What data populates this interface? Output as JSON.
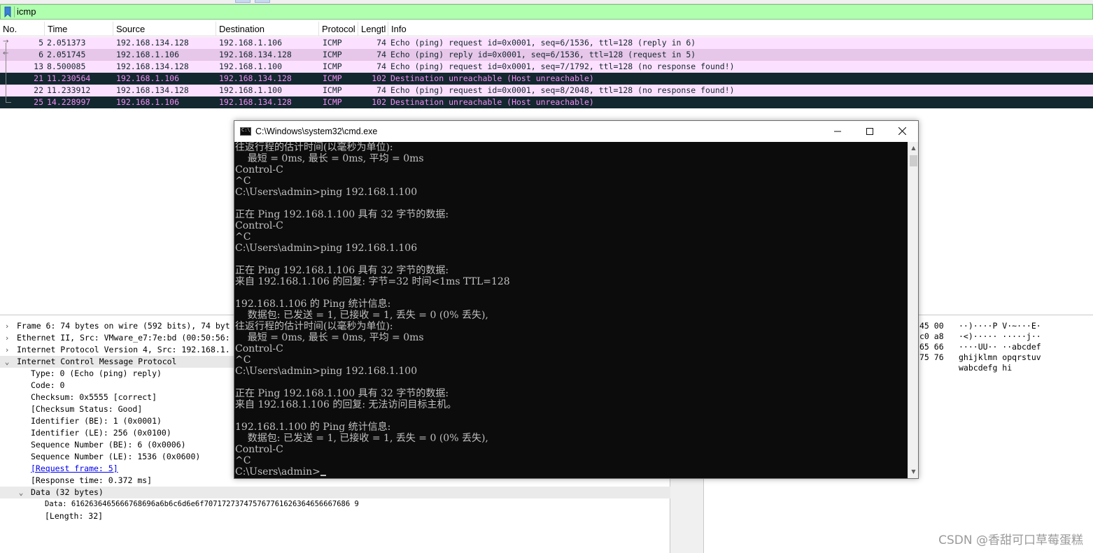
{
  "filter": {
    "value": "icmp"
  },
  "packet_list": {
    "columns": [
      "No.",
      "Time",
      "Source",
      "Destination",
      "Protocol",
      "Lengtl",
      "Info"
    ],
    "rows": [
      {
        "no": "5",
        "time": "2.051373",
        "src": "192.168.134.128",
        "dst": "192.168.1.106",
        "proto": "ICMP",
        "len": "74",
        "info": "Echo (ping) request  id=0x0001, seq=6/1536, ttl=128 (reply in 6)",
        "style": "echo"
      },
      {
        "no": "6",
        "time": "2.051745",
        "src": "192.168.1.106",
        "dst": "192.168.134.128",
        "proto": "ICMP",
        "len": "74",
        "info": "Echo (ping) reply    id=0x0001, seq=6/1536, ttl=128 (request in 5)",
        "style": "echo-sel"
      },
      {
        "no": "13",
        "time": "8.500085",
        "src": "192.168.134.128",
        "dst": "192.168.1.100",
        "proto": "ICMP",
        "len": "74",
        "info": "Echo (ping) request  id=0x0001, seq=7/1792, ttl=128 (no response found!)",
        "style": "echo"
      },
      {
        "no": "21",
        "time": "11.230564",
        "src": "192.168.1.106",
        "dst": "192.168.134.128",
        "proto": "ICMP",
        "len": "102",
        "info": "Destination unreachable (Host unreachable)",
        "style": "unreach"
      },
      {
        "no": "22",
        "time": "11.233912",
        "src": "192.168.134.128",
        "dst": "192.168.1.100",
        "proto": "ICMP",
        "len": "74",
        "info": "Echo (ping) request  id=0x0001, seq=8/2048, ttl=128 (no response found!)",
        "style": "echo"
      },
      {
        "no": "25",
        "time": "14.228997",
        "src": "192.168.1.106",
        "dst": "192.168.134.128",
        "proto": "ICMP",
        "len": "102",
        "info": "Destination unreachable (Host unreachable)",
        "style": "unreach"
      }
    ]
  },
  "details": {
    "frame": "Frame 6: 74 bytes on wire (592 bits), 74 byt",
    "ethernet": "Ethernet II, Src: VMware_e7:7e:bd (00:50:56:",
    "ip": "Internet Protocol Version 4, Src: 192.168.1.",
    "icmp": "Internet Control Message Protocol",
    "icmp_fields": [
      "Type: 0 (Echo (ping) reply)",
      "Code: 0",
      "Checksum: 0x5555 [correct]",
      "[Checksum Status: Good]",
      "Identifier (BE): 1 (0x0001)",
      "Identifier (LE): 256 (0x0100)",
      "Sequence Number (BE): 6 (0x0006)",
      "Sequence Number (LE): 1536 (0x0600)"
    ],
    "request_frame": "[Request frame: 5]",
    "response_time": "[Response time: 0.372 ms]",
    "data_header": "Data (32 bytes)",
    "data_value": "Data: 6162636465666768696a6b6c6d6e6f707172737475767761626364656667686 9",
    "data_length": "[Length: 32]"
  },
  "bytes_pane": {
    "hex": [
      "45 00",
      "c0 a8",
      "65 66",
      "75 76"
    ],
    "ascii": [
      "··)····P V·~···E·",
      "·<)····· ·····j··",
      "····UU·· ··abcdef",
      "ghijklmn opqrstuv",
      "wabcdefg hi"
    ]
  },
  "cmd": {
    "title": "C:\\Windows\\system32\\cmd.exe",
    "lines": [
      "往返行程的估计时间(以毫秒为单位):",
      "    最短 = 0ms, 最长 = 0ms, 平均 = 0ms",
      "Control-C",
      "^C",
      "C:\\Users\\admin>ping 192.168.1.100",
      "",
      "正在 Ping 192.168.1.100 具有 32 字节的数据:",
      "Control-C",
      "^C",
      "C:\\Users\\admin>ping 192.168.1.106",
      "",
      "正在 Ping 192.168.1.106 具有 32 字节的数据:",
      "来自 192.168.1.106 的回复: 字节=32 时间<1ms TTL=128",
      "",
      "192.168.1.106 的 Ping 统计信息:",
      "    数据包: 已发送 = 1, 已接收 = 1, 丢失 = 0 (0% 丢失),",
      "往返行程的估计时间(以毫秒为单位):",
      "    最短 = 0ms, 最长 = 0ms, 平均 = 0ms",
      "Control-C",
      "^C",
      "C:\\Users\\admin>ping 192.168.1.100",
      "",
      "正在 Ping 192.168.1.100 具有 32 字节的数据:",
      "来自 192.168.1.106 的回复: 无法访问目标主机。",
      "",
      "192.168.1.100 的 Ping 统计信息:",
      "    数据包: 已发送 = 1, 已接收 = 1, 丢失 = 0 (0% 丢失),",
      "Control-C",
      "^C",
      "C:\\Users\\admin>"
    ]
  },
  "watermark": "CSDN @香甜可口草莓蛋糕",
  "colors": {
    "filter_ok": "#afffaf",
    "echo_row": "#fce0ff",
    "unreach_row_bg": "#12272e",
    "unreach_row_fg": "#f78bf7",
    "console_bg": "#0c0c0c",
    "console_fg": "#c0c0c0"
  }
}
